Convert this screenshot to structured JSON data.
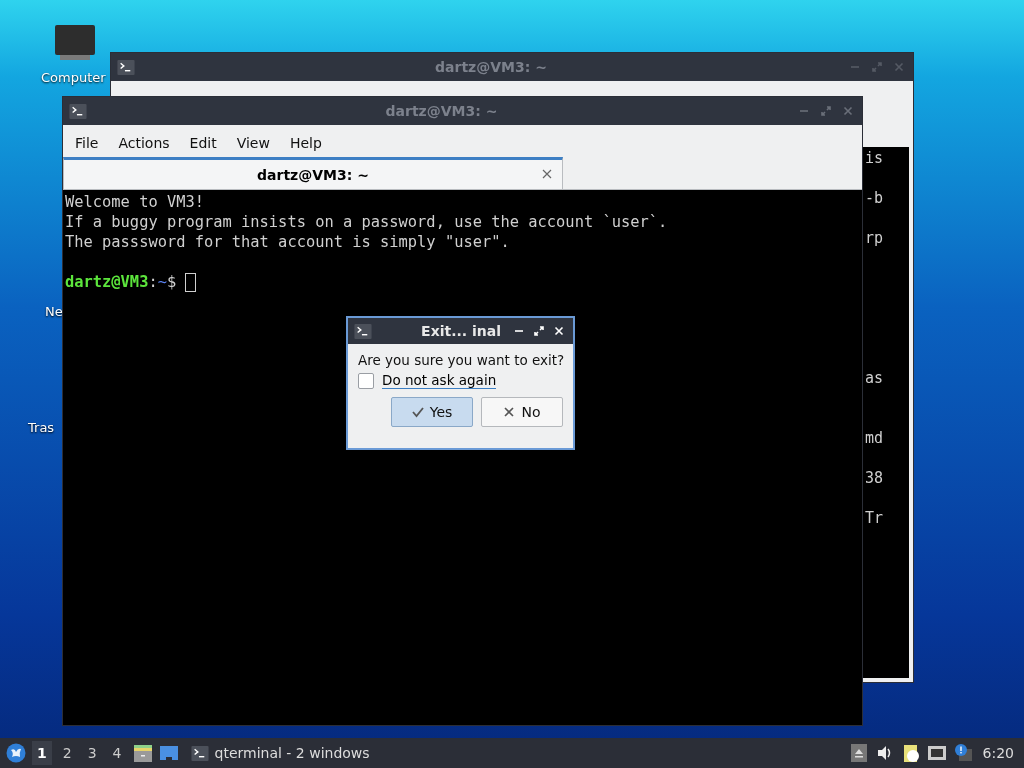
{
  "desktop_icons": [
    {
      "label": "Computer"
    },
    {
      "label": "Ne"
    },
    {
      "label": "Tras"
    }
  ],
  "back_window": {
    "title": "dartz@VM3: ~",
    "terminal_fragments": [
      "is",
      "-b",
      "rp",
      "as",
      "md",
      "38",
      "Tr"
    ]
  },
  "front_window": {
    "title": "dartz@VM3: ~",
    "menu": [
      "File",
      "Actions",
      "Edit",
      "View",
      "Help"
    ],
    "tab": {
      "label": "dartz@VM3: ~",
      "selected": true
    },
    "lines": [
      "Welcome to VM3!",
      "If a buggy program insists on a password, use the account `user`.",
      "The passsword for that account is simply \"user\"."
    ],
    "prompt": {
      "user_host": "dartz@VM3",
      "separator": ":",
      "path": "~",
      "symbol": "$"
    }
  },
  "dialog": {
    "title": "Exit... inal",
    "message": "Are you sure you want to exit?",
    "checkbox": {
      "label": "Do not ask again",
      "checked": false
    },
    "buttons": [
      {
        "label": "Yes",
        "kind": "yes",
        "selected": true
      },
      {
        "label": "No",
        "kind": "no",
        "selected": false
      }
    ]
  },
  "taskbar": {
    "workspaces": [
      {
        "label": "1",
        "selected": true
      },
      {
        "label": "2",
        "selected": false
      },
      {
        "label": "3",
        "selected": false
      },
      {
        "label": "4",
        "selected": false
      }
    ],
    "task": "qterminal - 2 windows",
    "clock": "6:20"
  }
}
